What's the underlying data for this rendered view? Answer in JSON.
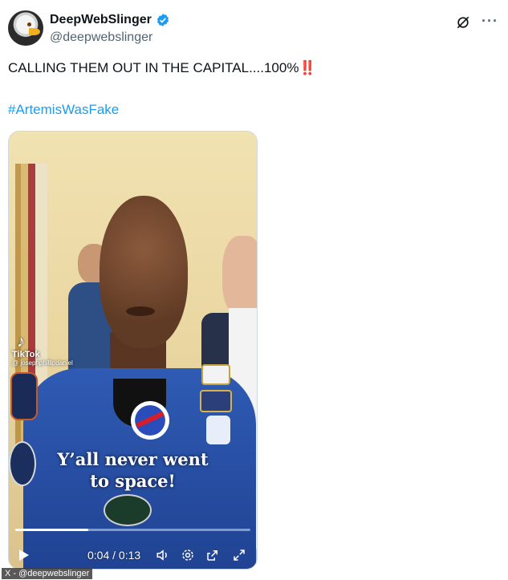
{
  "author": {
    "display_name": "DeepWebSlinger",
    "handle": "@deepwebslinger",
    "verified": true
  },
  "tweet": {
    "text": "CALLING THEM OUT IN THE CAPITAL....100%",
    "emphasis": "‼️",
    "hashtag": "#ArtemisWasFake"
  },
  "video": {
    "tiktok_label": "TikTok",
    "tiktok_handle": "@ josephphillipdaniel",
    "caption_line1": "Y’all never went",
    "caption_line2": "to space!",
    "current_time": "0:04",
    "separator": "/",
    "duration": "0:13",
    "progress_fraction": 0.31
  },
  "credit": "X - @deepwebslinger",
  "colors": {
    "link": "#1d9bf0",
    "secondary_text": "#536471",
    "verified": "#1d9bf0",
    "emphasis": "#e0245e"
  },
  "icons": [
    "verified-icon",
    "grok-icon",
    "more-icon",
    "tiktok-icon",
    "play-icon",
    "volume-icon",
    "settings-icon",
    "pip-icon",
    "fullscreen-icon"
  ]
}
